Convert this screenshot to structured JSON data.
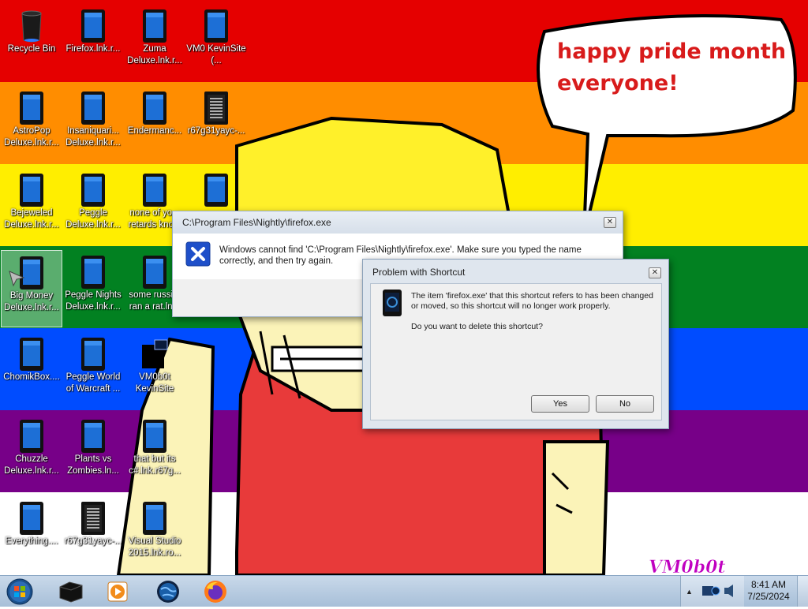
{
  "wallpaper": {
    "stripe_colors": [
      "#e50000",
      "#ff8d00",
      "#ffee00",
      "#028121",
      "#004cff",
      "#770088"
    ],
    "speech_text_line1": "happy pride month",
    "speech_text_line2": "everyone!",
    "signature_text": "VM0b0t"
  },
  "desktop_icons": [
    {
      "label": "Recycle Bin",
      "type": "recycle"
    },
    {
      "label": "Firefox.lnk.r...",
      "type": "app"
    },
    {
      "label": "Zuma Deluxe.lnk.r...",
      "type": "app"
    },
    {
      "label": "VM0 KevinSite (...",
      "type": "app"
    },
    {
      "label": "AstroPop Deluxe.lnk.r...",
      "type": "app"
    },
    {
      "label": "Insaniquari... Deluxe.lnk.r...",
      "type": "app"
    },
    {
      "label": "Endermanc...",
      "type": "app"
    },
    {
      "label": "r67g31yayc-...",
      "type": "doc"
    },
    {
      "label": "Bejeweled Deluxe.lnk.r...",
      "type": "app"
    },
    {
      "label": "Peggle Deluxe.lnk.r...",
      "type": "app"
    },
    {
      "label": "none of yo... retards kno...",
      "type": "app"
    },
    {
      "label": "",
      "type": "app"
    },
    {
      "label": "Big Money Deluxe.lnk.r...",
      "type": "app"
    },
    {
      "label": "Peggle Nights Deluxe.lnk.r...",
      "type": "app"
    },
    {
      "label": "some russi... ran a rat.ln...",
      "type": "app"
    },
    {
      "label": "ChomikBox....",
      "type": "app"
    },
    {
      "label": "Peggle World of Warcraft ...",
      "type": "app"
    },
    {
      "label": "VM0b0t KevinSite",
      "type": "black"
    },
    {
      "label": "Chuzzle Deluxe.lnk.r...",
      "type": "app"
    },
    {
      "label": "Plants vs Zombies.ln...",
      "type": "app"
    },
    {
      "label": "that but its c#.lnk.r67g...",
      "type": "app"
    },
    {
      "label": "Everything....",
      "type": "app"
    },
    {
      "label": "r67g31yayc-...",
      "type": "doc"
    },
    {
      "label": "Visual Studio 2015.lnk.ro...",
      "type": "app"
    }
  ],
  "dialog_error": {
    "title": "C:\\Program Files\\Nightly\\firefox.exe",
    "message": "Windows cannot find 'C:\\Program Files\\Nightly\\firefox.exe'. Make sure you typed the name correctly, and then try again.",
    "close_glyph": "✕",
    "icon": "error-x-icon"
  },
  "dialog_shortcut": {
    "title": "Problem with Shortcut",
    "message": "The item 'firefox.exe' that this shortcut refers to has been changed or moved, so this shortcut will no longer work properly.",
    "question": "Do you want to delete this shortcut?",
    "yes_label": "Yes",
    "no_label": "No",
    "close_glyph": "✕",
    "icon": "shortcut-app-icon"
  },
  "taskbar": {
    "time": "8:41 AM",
    "date": "7/25/2024",
    "start_icon": "windows-orb-icon",
    "pinned": [
      "black-box-icon",
      "media-player-icon",
      "globe-icon",
      "firefox-icon"
    ]
  }
}
